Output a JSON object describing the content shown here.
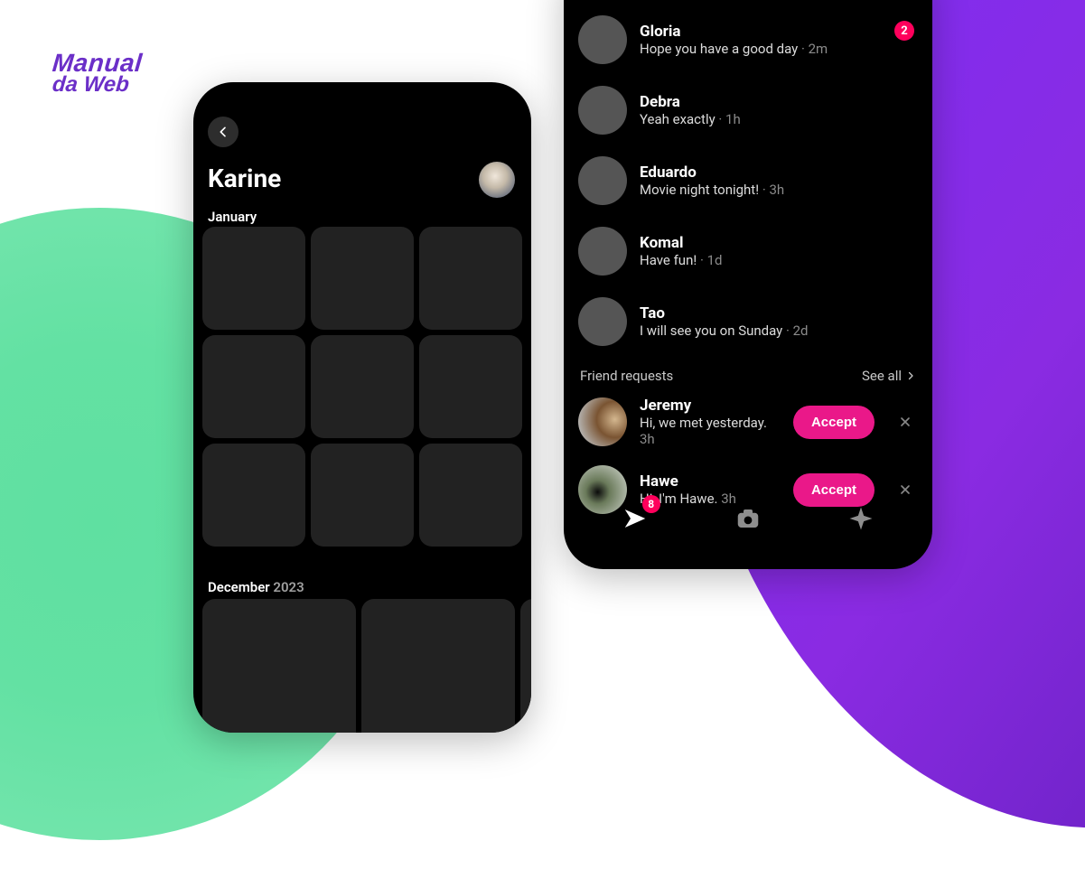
{
  "logo": {
    "line1": "Manual",
    "line2": "da Web"
  },
  "phone1": {
    "title": "Karine",
    "months": {
      "january": {
        "label": "January"
      },
      "december": {
        "label": "December",
        "year": "2023"
      }
    }
  },
  "phone2": {
    "chats": [
      {
        "name": "Gloria",
        "msg": "Hope you have a good day",
        "time": "2m",
        "badge": "2",
        "avatar": "av-gloria"
      },
      {
        "name": "Debra",
        "msg": "Yeah exactly",
        "time": "1h",
        "avatar": "av-debra"
      },
      {
        "name": "Eduardo",
        "msg": "Movie night tonight!",
        "time": "3h",
        "avatar": "av-eduardo"
      },
      {
        "name": "Komal",
        "msg": "Have fun!",
        "time": "1d",
        "avatar": "av-komal"
      },
      {
        "name": "Tao",
        "msg": "I will see you on Sunday",
        "time": "2d",
        "avatar": "av-tao"
      }
    ],
    "friendRequests": {
      "header": "Friend requests",
      "seeAll": "See all",
      "items": [
        {
          "name": "Jeremy",
          "msg": "Hi, we met yesterday.",
          "time": "3h",
          "accept": "Accept",
          "avatar": "av-jeremy"
        },
        {
          "name": "Hawe",
          "msg": "Hi, I'm Hawe.",
          "time": "3h",
          "accept": "Accept",
          "avatar": "av-hawe"
        }
      ]
    },
    "nav": {
      "sendBadge": "8"
    }
  }
}
